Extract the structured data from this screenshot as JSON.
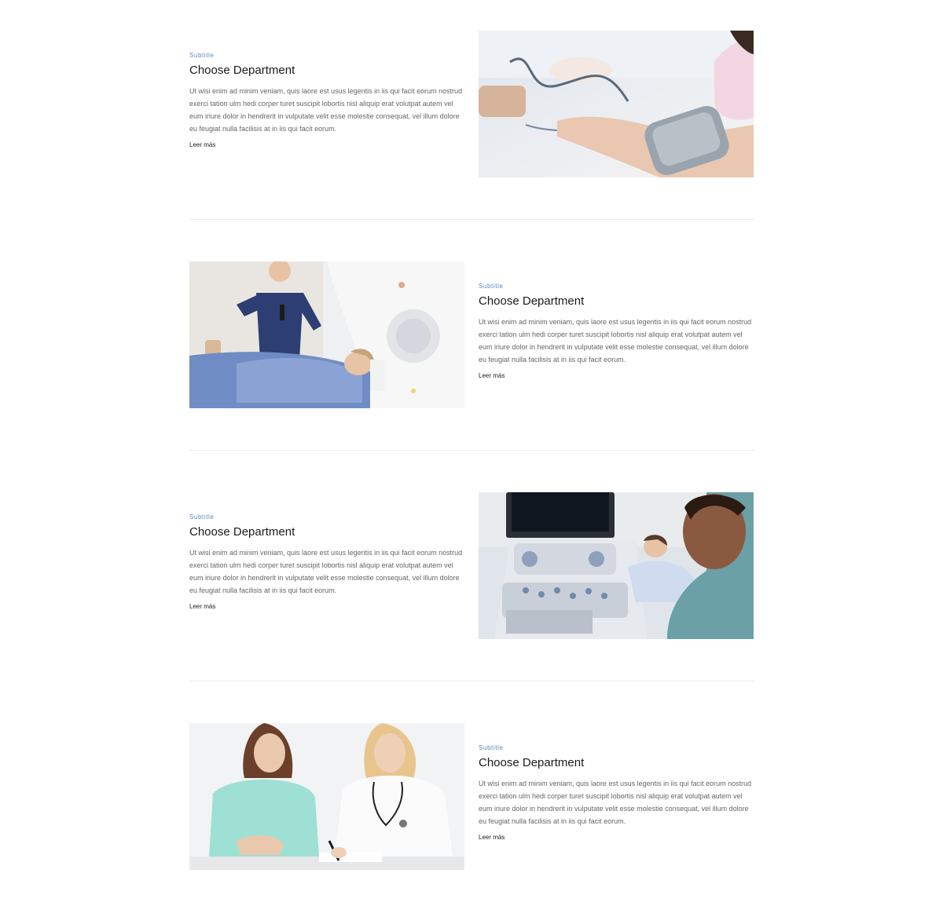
{
  "sections": [
    {
      "subtitle": "Subtitle",
      "title": "Choose Department",
      "description": "Ut wisi enim ad minim veniam, quis laore est usus legentis in iis qui facit eorum nostrud exerci tation ulm hedi corper turet suscipit lobortis nisl aliquip erat volutpat autem vel eum iriure dolor in hendrerit in vulputate velit esse molestie consequat, vel illum dolore eu feugiat nulla facilisis at in iis qui facit eorum.",
      "link": "Leer más",
      "image": "blood-pressure-check-photo"
    },
    {
      "subtitle": "Subtitle",
      "title": "Choose Department",
      "description": "Ut wisi enim ad minim veniam, quis laore est usus legentis in iis qui facit eorum nostrud exerci tation ulm hedi corper turet suscipit lobortis nisl aliquip erat volutpat autem vel eum iriure dolor in hendrerit in vulputate velit esse molestie consequat, vel illum dolore eu feugiat nulla facilisis at in iis qui facit eorum.",
      "link": "Leer más",
      "image": "mri-scanner-photo"
    },
    {
      "subtitle": "Subtitle",
      "title": "Choose Department",
      "description": "Ut wisi enim ad minim veniam, quis laore est usus legentis in iis qui facit eorum nostrud exerci tation ulm hedi corper turet suscipit lobortis nisl aliquip erat volutpat autem vel eum iriure dolor in hendrerit in vulputate velit esse molestie consequat, vel illum dolore eu feugiat nulla facilisis at in iis qui facit eorum.",
      "link": "Leer más",
      "image": "ultrasound-exam-photo"
    },
    {
      "subtitle": "Subtitle",
      "title": "Choose Department",
      "description": "Ut wisi enim ad minim veniam, quis laore est usus legentis in iis qui facit eorum nostrud exerci tation ulm hedi corper turet suscipit lobortis nisl aliquip erat volutpat autem vel eum iriure dolor in hendrerit in vulputate velit esse molestie consequat, vel illum dolore eu feugiat nulla facilisis at in iis qui facit eorum.",
      "link": "Leer más",
      "image": "doctor-consultation-photo"
    }
  ],
  "colors": {
    "accent": "#5b84c4",
    "heading": "#1a1a1a",
    "body_text": "#666666",
    "divider": "#ececec"
  }
}
